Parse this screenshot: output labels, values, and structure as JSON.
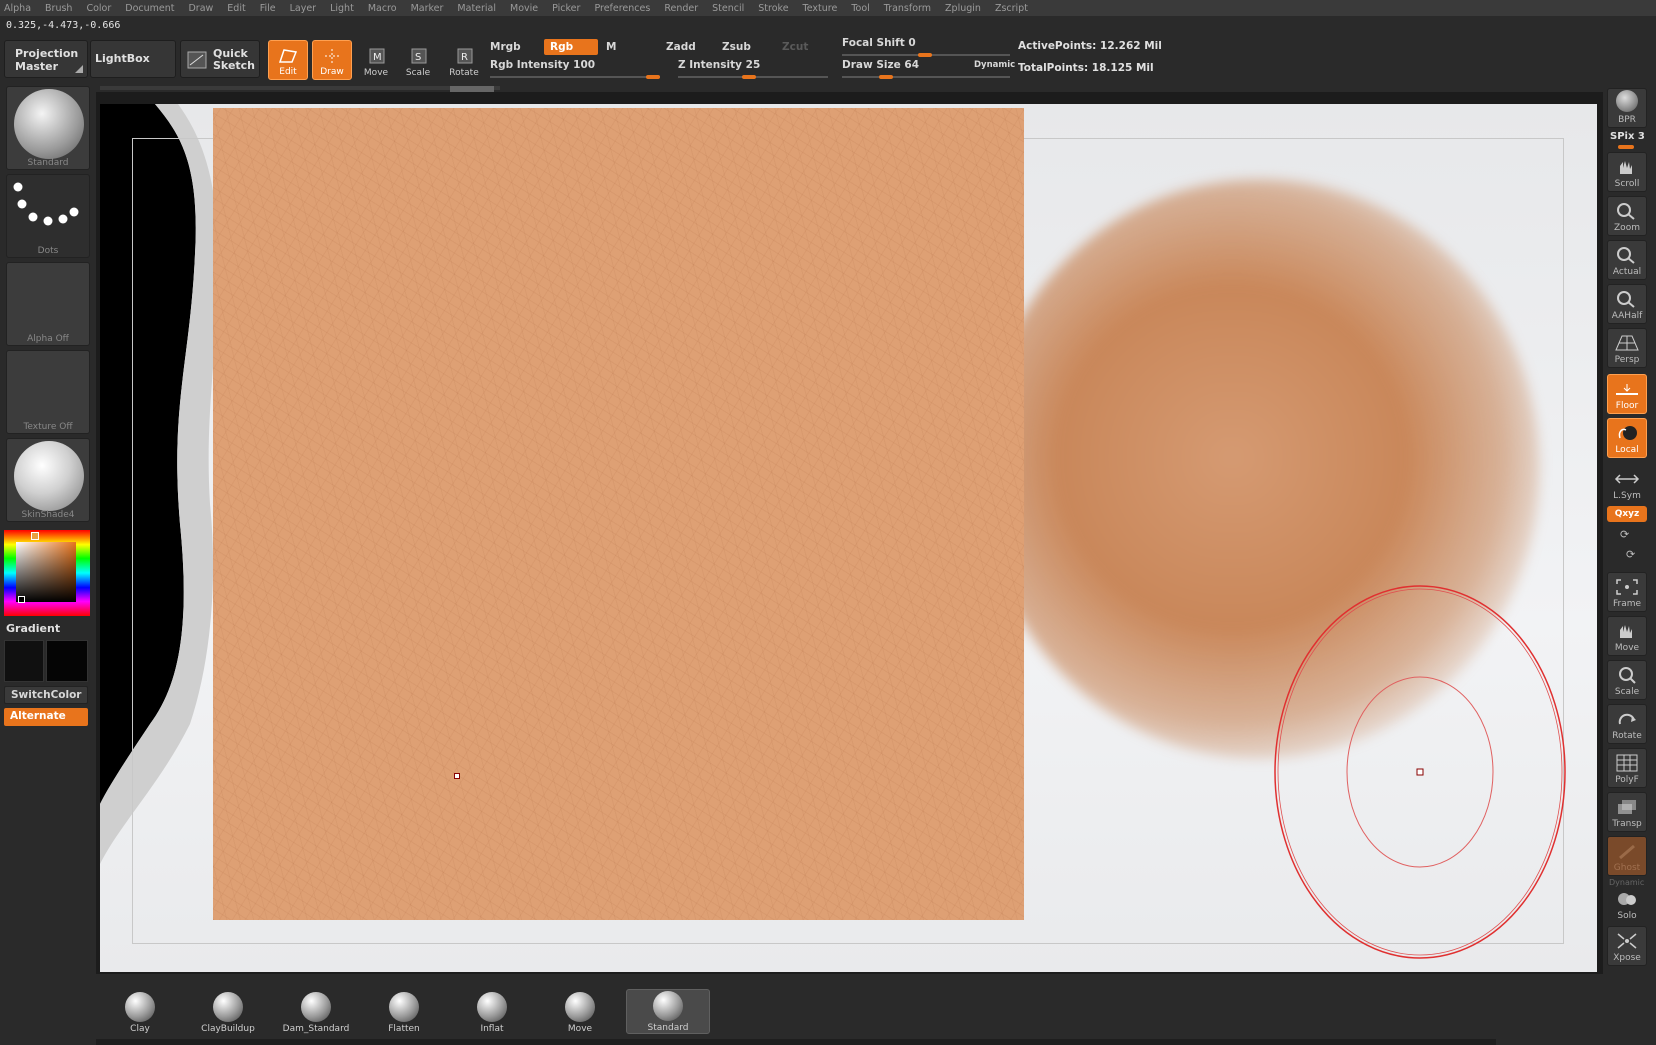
{
  "menu": [
    "Alpha",
    "Brush",
    "Color",
    "Document",
    "Draw",
    "Edit",
    "File",
    "Layer",
    "Light",
    "Macro",
    "Marker",
    "Material",
    "Movie",
    "Picker",
    "Preferences",
    "Render",
    "Stencil",
    "Stroke",
    "Texture",
    "Tool",
    "Transform",
    "Zplugin",
    "Zscript"
  ],
  "coords": "0.325,-4.473,-0.666",
  "toolbar": {
    "projection_master_1": "Projection",
    "projection_master_2": "Master",
    "lightbox": "LightBox",
    "quick_sketch_1": "Quick",
    "quick_sketch_2": "Sketch",
    "edit": "Edit",
    "draw": "Draw",
    "move": "Move",
    "scale": "Scale",
    "rotate": "Rotate",
    "mrgb": "Mrgb",
    "rgb": "Rgb",
    "m": "M",
    "zadd": "Zadd",
    "zsub": "Zsub",
    "zcut": "Zcut",
    "rgb_intensity": "Rgb Intensity 100",
    "z_intensity": "Z Intensity 25",
    "focal_shift": "Focal Shift 0",
    "draw_size": "Draw Size 64",
    "dynamic": "Dynamic",
    "active_points": "ActivePoints: 12.262 Mil",
    "total_points": "TotalPoints: 18.125 Mil",
    "rgb_intensity_value": 100,
    "z_intensity_value": 25,
    "focal_shift_value": 0,
    "draw_size_value": 64
  },
  "left_shelf": {
    "brush": "Standard",
    "stroke": "Dots",
    "alpha": "Alpha Off",
    "texture": "Texture Off",
    "material": "SkinShade4",
    "gradient": "Gradient",
    "switch_color": "SwitchColor",
    "alternate": "Alternate"
  },
  "right_shelf": {
    "bpr": "BPR",
    "spix": "SPix 3",
    "scroll": "Scroll",
    "zoom": "Zoom",
    "actual": "Actual",
    "aahalf": "AAHalf",
    "persp": "Persp",
    "floor": "Floor",
    "local": "Local",
    "lsym": "L.Sym",
    "xyz": "Qxyz",
    "frame": "Frame",
    "move": "Move",
    "scale": "Scale",
    "rotate": "Rotate",
    "polyf": "PolyF",
    "transp": "Transp",
    "ghost": "Ghost",
    "dynamic": "Dynamic",
    "solo": "Solo",
    "xpose": "Xpose"
  },
  "brushes": [
    "Clay",
    "ClayBuildup",
    "Dam_Standard",
    "Flatten",
    "Inflat",
    "Move",
    "Standard"
  ],
  "colors": {
    "accent": "#e8741c",
    "skin": "#dea074",
    "brush_cursor": "#e03030"
  }
}
